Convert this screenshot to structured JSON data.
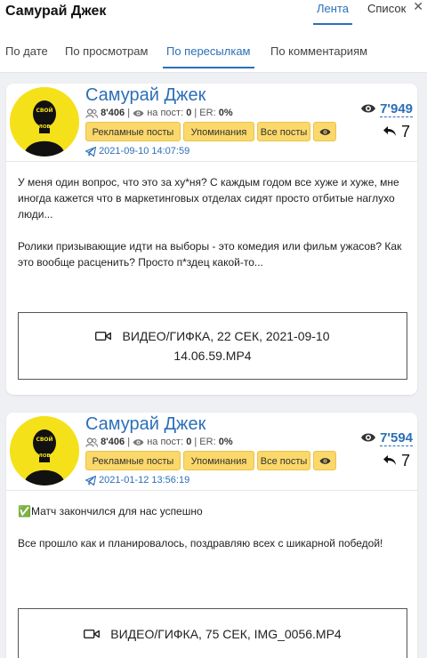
{
  "header": {
    "title": "Самурай Джек",
    "tab_feed": "Лента",
    "tab_list": "Список",
    "close": "✕"
  },
  "sort_tabs": [
    "По дате",
    "По просмотрам",
    "По пересылкам",
    "По комментариям"
  ],
  "active_sort": "По пересылкам",
  "colors": {
    "accent": "#2c6fb7",
    "tag": "#fbd86a",
    "avatar_bg": "#f5e11a"
  },
  "posts": [
    {
      "channel": "Самурай Джек",
      "avatar_text_1": "СВОЙ",
      "avatar_text_2": "ЧЕЛОВЕК",
      "subscribers": "8'406",
      "per_post_label": "на пост:",
      "per_post": "0",
      "er_label": "ER:",
      "er": "0%",
      "btn_ads": "Рекламные посты",
      "btn_mentions": "Упоминания",
      "btn_all": "Все посты",
      "date": "2021-09-10 14:07:59",
      "views": "7'949",
      "shares": "7",
      "paragraphs": [
        "У меня один вопрос, что это за ху*ня? С каждым годом все хуже и хуже, мне иногда кажется что в маркетинговых отделах сидят просто отбитые наглухо люди...",
        "Ролики призывающие идти на выборы - это комедия или фильм ужасов? Как это вообще расценить? Просто п*здец какой-то..."
      ],
      "media_line1": "ВИДЕО/ГИФКА, 22 СЕК, 2021-09-10",
      "media_line2": "14.06.59.MP4"
    },
    {
      "channel": "Самурай Джек",
      "avatar_text_1": "СВОЙ",
      "avatar_text_2": "ЧЕЛОВЕК",
      "subscribers": "8'406",
      "per_post_label": "на пост:",
      "per_post": "0",
      "er_label": "ER:",
      "er": "0%",
      "btn_ads": "Рекламные посты",
      "btn_mentions": "Упоминания",
      "btn_all": "Все посты",
      "date": "2021-01-12 13:56:19",
      "views": "7'594",
      "shares": "7",
      "check": "✅",
      "paragraphs": [
        "Матч закончился для нас успешно",
        "Все прошло как и планировалось, поздравляю всех с шикарной победой!"
      ],
      "media_line1": "ВИДЕО/ГИФКА, 75 СЕК, IMG_0056.MP4"
    }
  ]
}
